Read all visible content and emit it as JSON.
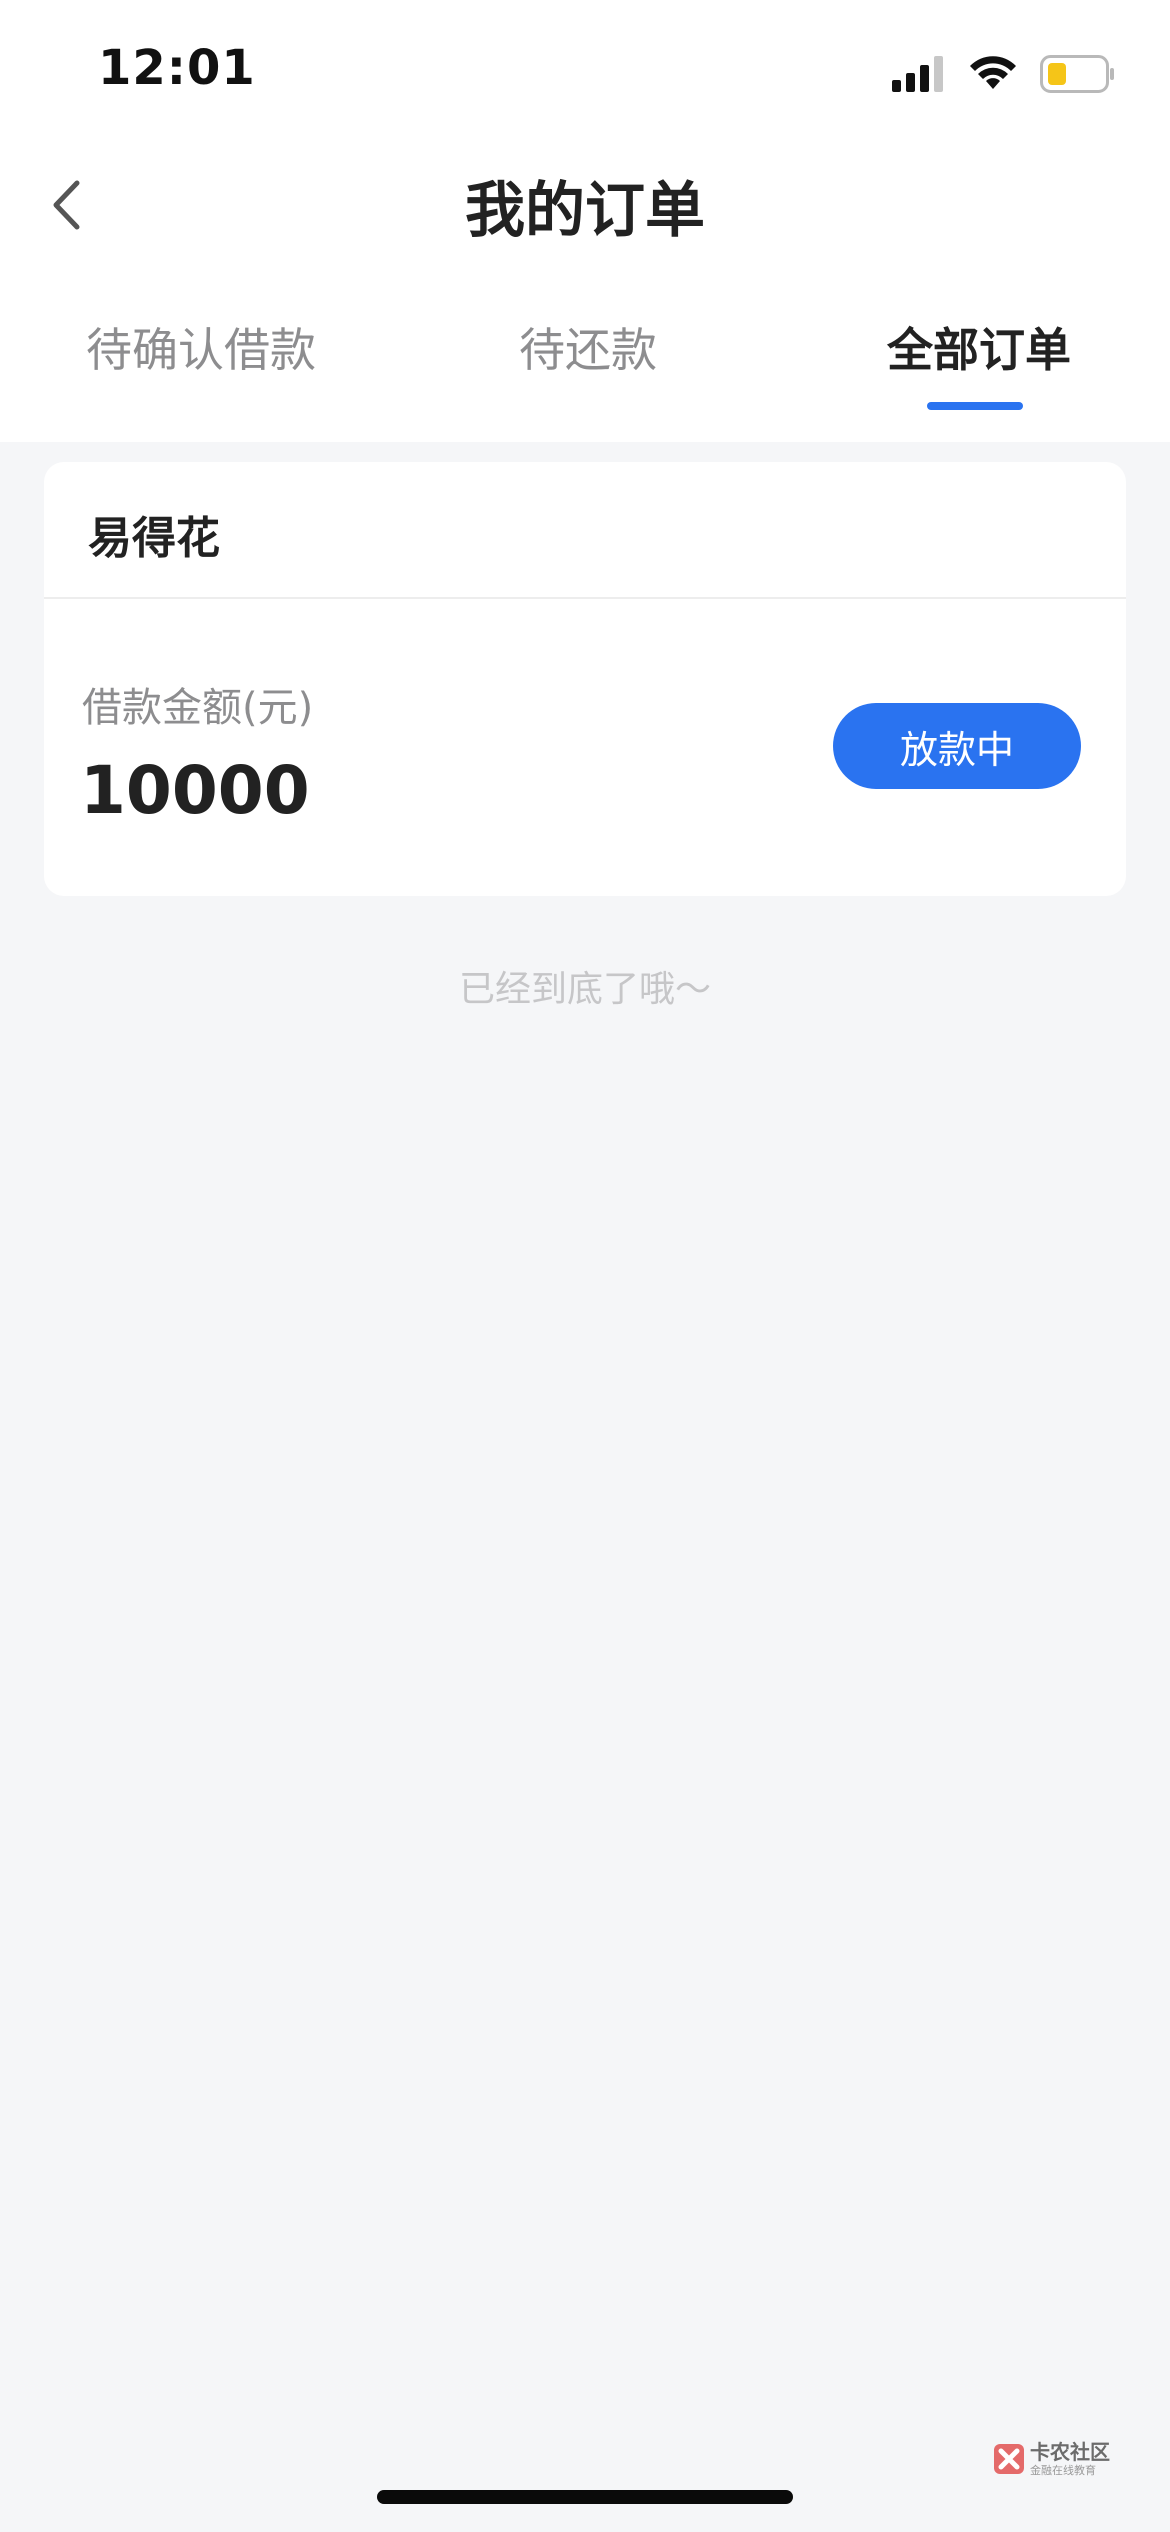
{
  "status_bar": {
    "time": "12:01",
    "battery_color": "#f5c518"
  },
  "header": {
    "title": "我的订单",
    "back_icon": "chevron-left-icon"
  },
  "tabs": [
    {
      "label": "待确认借款",
      "active": false
    },
    {
      "label": "待还款",
      "active": false
    },
    {
      "label": "全部订单",
      "active": true
    }
  ],
  "orders": [
    {
      "product": "易得花",
      "amount_label": "借款金额(元)",
      "amount": "10000",
      "status": "放款中"
    }
  ],
  "list_end_text": "已经到底了哦～",
  "watermark": {
    "brand": "卡农社区",
    "sub": "金融在线教育"
  },
  "colors": {
    "accent": "#2a73f0",
    "background": "#f5f6f8",
    "card": "#ffffff",
    "muted_text": "#8d8d8f"
  }
}
